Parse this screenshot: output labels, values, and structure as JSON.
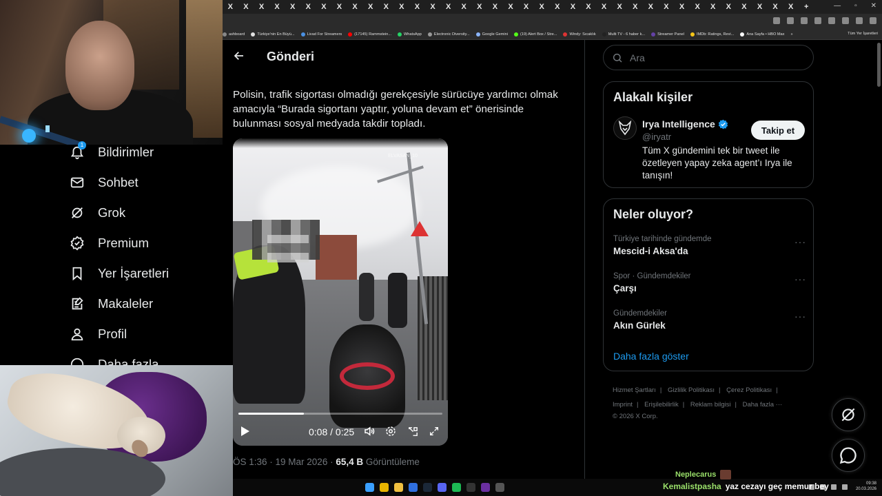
{
  "browser": {
    "tab_glyph": "X",
    "tab_count": 37,
    "bookmarks": [
      {
        "label": "ashboard",
        "color": "#888888"
      },
      {
        "label": "Türkiye'nin En Büyü...",
        "color": "#e0e0e0"
      },
      {
        "label": "Livad For Streamers",
        "color": "#4a90e2"
      },
      {
        "label": "(17145) Rammstein...",
        "color": "#ff0000"
      },
      {
        "label": "WhatsApp",
        "color": "#25d366"
      },
      {
        "label": "Electronic Diversity...",
        "color": "#999999"
      },
      {
        "label": "Google Gemini",
        "color": "#8ab4f8"
      },
      {
        "label": "(19) Alert Box / Stre...",
        "color": "#53fc18"
      },
      {
        "label": "Windy: Sıcaklık",
        "color": "#d33"
      },
      {
        "label": "Multi TV - 6 haber k...",
        "color": "#222222"
      },
      {
        "label": "Streamer Panel",
        "color": "#6441a5"
      },
      {
        "label": "IMDb: Ratings, Revi...",
        "color": "#f5c518"
      },
      {
        "label": "Ana Sayfa • HBO Max",
        "color": "#ffffff"
      }
    ],
    "bookmarks_more": "»",
    "all_bookmarks": "Tüm Yer İşaretleri"
  },
  "nav": {
    "notifications": {
      "label": "Bildirimler",
      "badge": "1"
    },
    "chat": {
      "label": "Sohbet"
    },
    "grok": {
      "label": "Grok"
    },
    "premium": {
      "label": "Premium"
    },
    "bookmarks": {
      "label": "Yer İşaretleri"
    },
    "articles": {
      "label": "Makaleler"
    },
    "profile": {
      "label": "Profil"
    },
    "more": {
      "label": "Daha fazla"
    }
  },
  "post": {
    "title": "Gönderi",
    "text": "Polisin, trafik sigortası olmadığı gerekçesiyle sürücüye yardımcı olmak amacıyla “Burada sigortanı yaptır, yoluna devam et” önerisinde bulunması sosyal medyada takdir topladı.",
    "video": {
      "watermark": "ELVASAN_10",
      "time": "0:08 / 0:25",
      "progress": 0.32
    },
    "meta_time": "ÖS 1:36 · 19 Mar 2026 · ",
    "views_count": "65,4 B",
    "views_label": " Görüntüleme"
  },
  "sidebar": {
    "search_placeholder": "Ara",
    "related": {
      "title": "Alakalı kişiler",
      "person": {
        "name": "Irya Intelligence",
        "handle": "@iryatr",
        "follow_label": "Takip et",
        "bio": "Tüm X gündemini tek bir tweet ile özetleyen yapay zeka agent’ı Irya ile tanışın!"
      }
    },
    "trends": {
      "title": "Neler oluyor?",
      "items": [
        {
          "category": "Türkiye tarihinde gündemde",
          "name": "Mescid-i Aksa'da"
        },
        {
          "category": "Spor · Gündemdekiler",
          "name": "Çarşı"
        },
        {
          "category": "Gündemdekiler",
          "name": "Akın Gürlek"
        }
      ],
      "more_dots": "···",
      "show_more": "Daha fazla göster"
    },
    "footer": {
      "links": [
        "Hizmet Şartları",
        "Gizlilik Politikası",
        "Çerez Politikası",
        "Imprint",
        "Erişilebilirlik",
        "Reklam bilgisi",
        "Daha fazla ···"
      ],
      "copyright": "© 2026 X Corp."
    }
  },
  "overlay_chat": {
    "line1_user": "Neplecarus",
    "line2_user": "Kemalistpasha",
    "line2_message": "yaz cezayı geç memur bey"
  },
  "taskbar": {
    "time": "09:38",
    "date": "20.03.2026"
  },
  "colors": {
    "accent": "#1d9bf0",
    "verified": "#1d9bf0",
    "text": "#e7e9ea",
    "muted": "#71767b",
    "border": "#2f3336"
  }
}
